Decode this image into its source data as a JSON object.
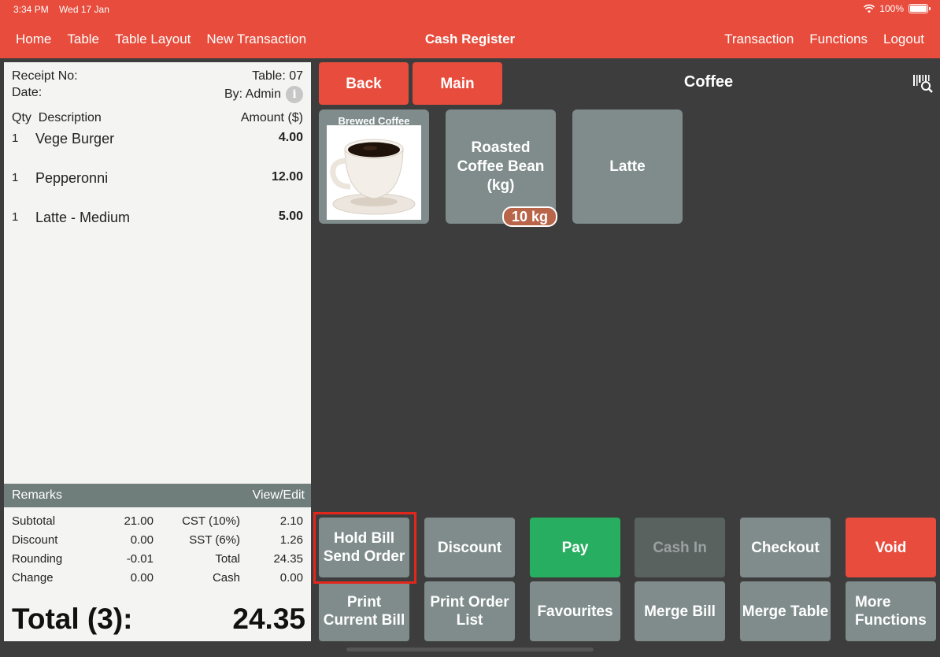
{
  "status": {
    "time": "3:34 PM",
    "date": "Wed 17 Jan",
    "battery": "100%"
  },
  "nav": {
    "left": [
      "Home",
      "Table",
      "Table Layout",
      "New Transaction"
    ],
    "title": "Cash Register",
    "right": [
      "Transaction",
      "Functions",
      "Logout"
    ]
  },
  "receipt": {
    "receipt_no_label": "Receipt No:",
    "table_label": "Table: 07",
    "date_label": "Date:",
    "by_label": "By: Admin",
    "qty_desc_header": "Qty  Description",
    "amount_header": "Amount ($)",
    "items": [
      {
        "qty": "1",
        "desc": "Vege Burger",
        "amount": "4.00"
      },
      {
        "qty": "1",
        "desc": "Pepperonni",
        "amount": "12.00"
      },
      {
        "qty": "1",
        "desc": "Latte - Medium",
        "amount": "5.00"
      }
    ],
    "remarks_label": "Remarks",
    "view_edit": "View/Edit",
    "totals": [
      [
        "Subtotal",
        "21.00",
        "CST (10%)",
        "2.10"
      ],
      [
        "Discount",
        "0.00",
        "SST (6%)",
        "1.26"
      ],
      [
        "Rounding",
        "-0.01",
        "Total",
        "24.35"
      ],
      [
        "Change",
        "0.00",
        "Cash",
        "0.00"
      ]
    ],
    "grand_label": "Total (3):",
    "grand_value": "24.35"
  },
  "menu": {
    "back": "Back",
    "main": "Main",
    "category": "Coffee",
    "tiles": {
      "brewed": "Brewed Coffee",
      "roasted": "Roasted Coffee Bean (kg)",
      "roasted_badge": "10 kg",
      "latte": "Latte"
    }
  },
  "actions": {
    "hold_bill": "Hold Bill Send Order",
    "discount": "Discount",
    "pay": "Pay",
    "cash_in": "Cash In",
    "checkout": "Checkout",
    "void": "Void",
    "print_current": "Print Current Bill",
    "print_order": "Print Order List",
    "favourites": "Favourites",
    "merge_bill": "Merge Bill",
    "merge_table": "Merge Table",
    "more_functions": "More Functions"
  },
  "colors": {
    "accent": "#e74c3c",
    "tile": "#7f8c8b",
    "pay": "#27ae60",
    "background": "#3d3d3d"
  }
}
